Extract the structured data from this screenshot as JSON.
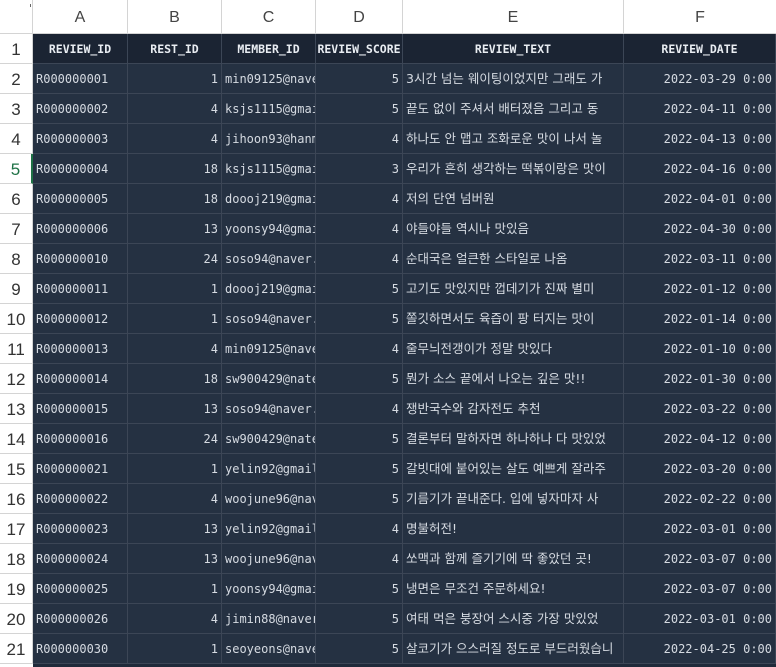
{
  "column_letters": [
    "A",
    "B",
    "C",
    "D",
    "E",
    "F"
  ],
  "row_numbers": [
    "1",
    "2",
    "3",
    "4",
    "5",
    "6",
    "7",
    "8",
    "9",
    "10",
    "11",
    "12",
    "13",
    "14",
    "15",
    "16",
    "17",
    "18",
    "19",
    "20",
    "21"
  ],
  "active_row": "5",
  "headers": [
    "REVIEW_ID",
    "REST_ID",
    "MEMBER_ID",
    "REVIEW_SCORE",
    "REVIEW_TEXT",
    "REVIEW_DATE"
  ],
  "rows": [
    [
      "R000000001",
      "1",
      "min09125@nave",
      "5",
      "3시간 넘는 웨이팅이었지만 그래도 가",
      "2022-03-29 0:00"
    ],
    [
      "R000000002",
      "4",
      "ksjs1115@gmai",
      "5",
      "끝도 없이 주셔서 배터졌음 그리고 동",
      "2022-04-11 0:00"
    ],
    [
      "R000000003",
      "4",
      "jihoon93@hanm",
      "4",
      "하나도 안 맵고 조화로운 맛이 나서 놀",
      "2022-04-13 0:00"
    ],
    [
      "R000000004",
      "18",
      "ksjs1115@gmai",
      "3",
      "우리가 흔히 생각하는 떡볶이랑은 맛이",
      "2022-04-16 0:00"
    ],
    [
      "R000000005",
      "18",
      "doooj219@gmai",
      "4",
      "저의 단연 넘버원",
      "2022-04-01 0:00"
    ],
    [
      "R000000006",
      "13",
      "yoonsy94@gmai",
      "4",
      "야들야들 역시나 맛있음",
      "2022-04-30 0:00"
    ],
    [
      "R000000010",
      "24",
      "soso94@naver.",
      "4",
      "순대국은 얼큰한 스타일로 나옴",
      "2022-03-11 0:00"
    ],
    [
      "R000000011",
      "1",
      "doooj219@gmai",
      "5",
      "고기도 맛있지만 껍데기가 진짜 별미",
      "2022-01-12 0:00"
    ],
    [
      "R000000012",
      "1",
      "soso94@naver.",
      "5",
      "쫄깃하면서도 육즙이 팡 터지는 맛이",
      "2022-01-14 0:00"
    ],
    [
      "R000000013",
      "4",
      "min09125@nave",
      "4",
      "줄무늬전갱이가 정말 맛있다",
      "2022-01-10 0:00"
    ],
    [
      "R000000014",
      "18",
      "sw900429@nate",
      "5",
      "뭔가 소스 끝에서 나오는 깊은 맛!!",
      "2022-01-30 0:00"
    ],
    [
      "R000000015",
      "13",
      "soso94@naver.",
      "4",
      "쟁반국수와 감자전도 추천",
      "2022-03-22 0:00"
    ],
    [
      "R000000016",
      "24",
      "sw900429@nate",
      "5",
      "결론부터 말하자면 하나하나 다 맛있었",
      "2022-04-12 0:00"
    ],
    [
      "R000000021",
      "1",
      "yelin92@gmail",
      "5",
      "갈빗대에 붙어있는 살도 예쁘게 잘라주",
      "2022-03-20 0:00"
    ],
    [
      "R000000022",
      "4",
      "woojune96@nav",
      "5",
      "기름기가 끝내준다. 입에 넣자마자 사",
      "2022-02-22 0:00"
    ],
    [
      "R000000023",
      "13",
      "yelin92@gmail",
      "4",
      "명불허전!",
      "2022-03-01 0:00"
    ],
    [
      "R000000024",
      "13",
      "woojune96@nav",
      "4",
      "쏘맥과 함께 즐기기에 딱 좋았던 곳!",
      "2022-03-07 0:00"
    ],
    [
      "R000000025",
      "1",
      "yoonsy94@gmai",
      "5",
      "냉면은 무조건 주문하세요!",
      "2022-03-07 0:00"
    ],
    [
      "R000000026",
      "4",
      "jimin88@naver",
      "5",
      "여태 먹은 붕장어 스시중 가장 맛있었",
      "2022-03-01 0:00"
    ],
    [
      "R000000030",
      "1",
      "seoyeons@nave",
      "5",
      "살코기가 으스러질 정도로 부드러웠습니",
      "2022-04-25 0:00"
    ]
  ]
}
